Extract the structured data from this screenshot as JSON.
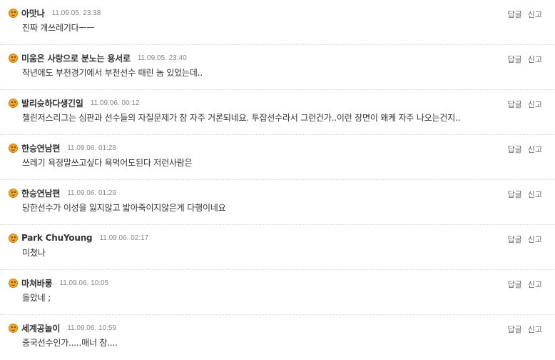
{
  "actions": {
    "reply_label": "답글",
    "report_label": "신고"
  },
  "comments": [
    {
      "author": "아맛나",
      "time": "11.09.05. 23:38",
      "text": "진짜 개쓰레기다ㅡㅡ"
    },
    {
      "author": "미움은 사랑으로 분노는 용서로",
      "time": "11.09.05. 23:40",
      "text": "작년에도 부천경기에서 부천선수 때린 놈 있었는데.."
    },
    {
      "author": "발리슛하다생긴일",
      "time": "11.09.06. 00:12",
      "text": "첼린저스리그는 심판과 선수들의 자질문제가 참 자주 거론되네요. 투잡선수라서 그런건가..이런 장면이 왜케 자주 나오는건지.."
    },
    {
      "author": "한승연남편",
      "time": "11.09.06. 01:28",
      "text": "쓰레기 욕정말쓰고싶다 욕먹어도된다 저런사람은"
    },
    {
      "author": "한승연남편",
      "time": "11.09.06. 01:29",
      "text": "당한선수가 이성을 잃지않고 밟아죽이지않은게 다행이네요"
    },
    {
      "author": "Park ChuYoung",
      "time": "11.09.06. 02:17",
      "text": "미쳤나"
    },
    {
      "author": "마쳐바롱",
      "time": "11.09.06. 10:05",
      "text": "돌았네 ;"
    },
    {
      "author": "세계공놀이",
      "time": "11.09.06. 10:59",
      "text": "중국선수인가.....매너 참...."
    }
  ]
}
